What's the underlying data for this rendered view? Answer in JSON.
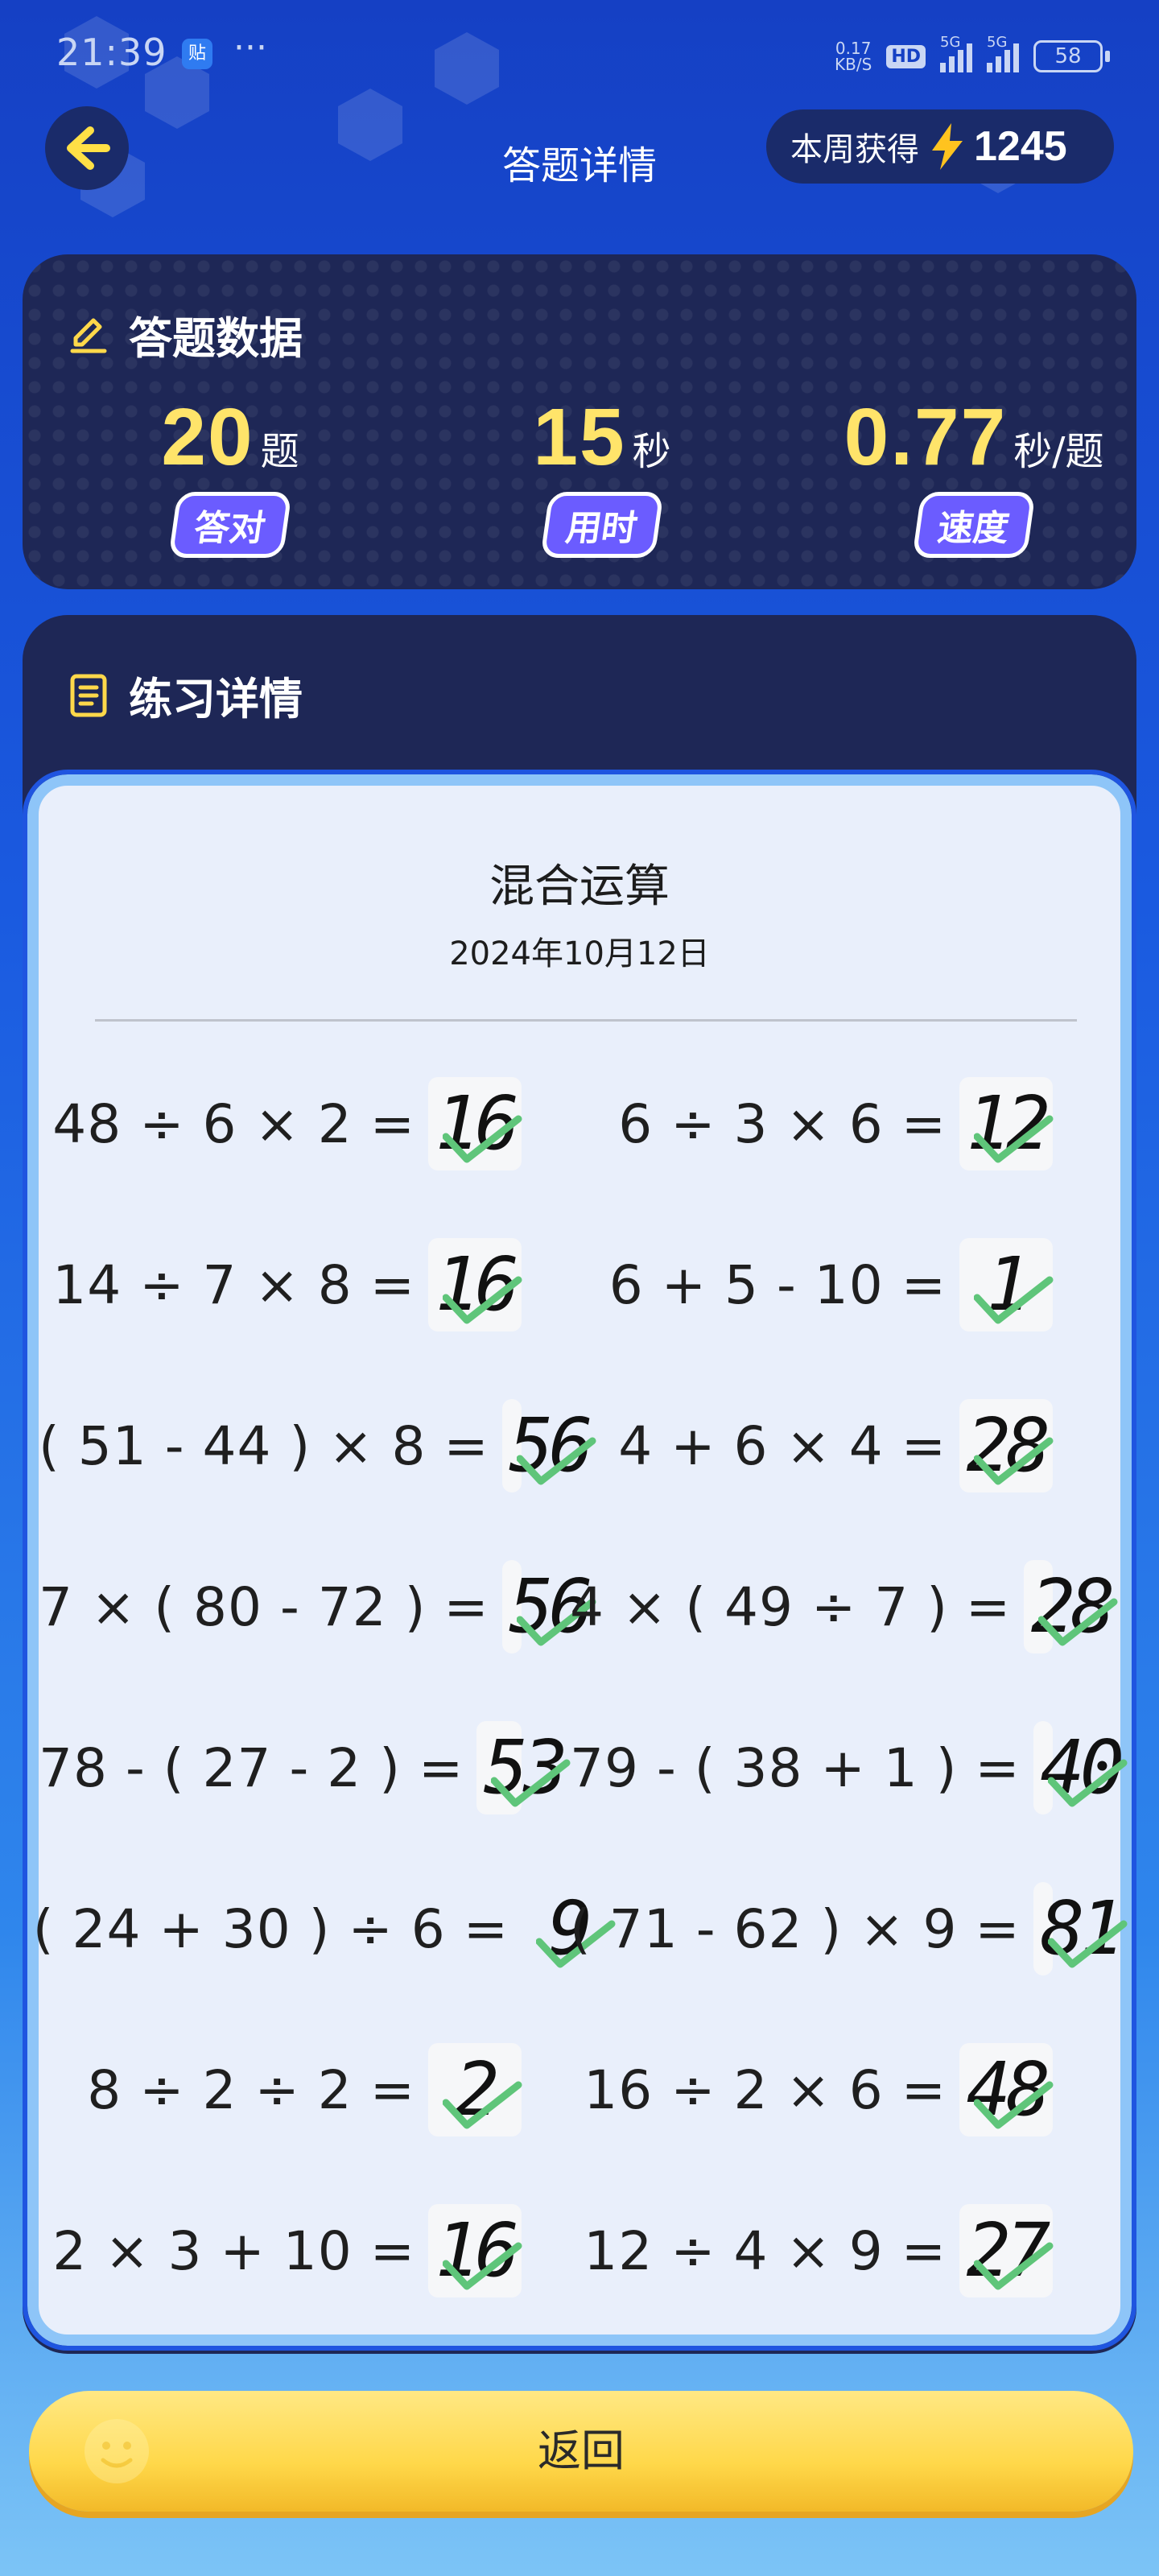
{
  "status_bar": {
    "time": "21:39",
    "sticker": "贴",
    "more": "···",
    "net_speed_value": "0.17",
    "net_speed_unit": "KB/S",
    "hd_label": "HD",
    "signal_label_1": "5G",
    "signal_label_2": "5G",
    "battery": "58"
  },
  "header": {
    "title": "答题详情",
    "weekly_label": "本周获得",
    "weekly_value": "1245"
  },
  "stats": {
    "heading": "答题数据",
    "items": [
      {
        "value": "20",
        "unit": "题",
        "tag": "答对"
      },
      {
        "value": "15",
        "unit": "秒",
        "tag": "用时"
      },
      {
        "value": "0.77",
        "unit": "秒/题",
        "tag": "速度"
      }
    ]
  },
  "practice": {
    "heading": "练习详情",
    "sheet_title": "混合运算",
    "sheet_date": "2024年10月12日",
    "questions": [
      {
        "expr": "48 ÷ 6 × 2 =",
        "answer": "16"
      },
      {
        "expr": "6 ÷ 3 × 6 =",
        "answer": "12"
      },
      {
        "expr": "14 ÷ 7 × 8 =",
        "answer": "16"
      },
      {
        "expr": "6 + 5 - 10 =",
        "answer": "1"
      },
      {
        "expr": "( 51 - 44 ) × 8 =",
        "answer": "56"
      },
      {
        "expr": "4 + 6 × 4 =",
        "answer": "28"
      },
      {
        "expr": "7 × ( 80 - 72 ) =",
        "answer": "56"
      },
      {
        "expr": "4 × ( 49 ÷ 7 ) =",
        "answer": "28"
      },
      {
        "expr": "78 - ( 27 - 2 ) =",
        "answer": "53"
      },
      {
        "expr": "79 - ( 38 + 1 ) =",
        "answer": "40"
      },
      {
        "expr": "( 24 + 30 ) ÷ 6 =",
        "answer": "9"
      },
      {
        "expr": "( 71 - 62 ) × 9 =",
        "answer": "81"
      },
      {
        "expr": "8 ÷ 2 ÷ 2 =",
        "answer": "2"
      },
      {
        "expr": "16 ÷ 2 × 6 =",
        "answer": "48"
      },
      {
        "expr": "2 × 3 + 10 =",
        "answer": "16"
      },
      {
        "expr": "12 ÷ 4 × 9 =",
        "answer": "27"
      }
    ]
  },
  "footer": {
    "return_label": "返回"
  },
  "colors": {
    "accent_yellow": "#ffe46a",
    "check_green": "#5fc57a",
    "card_navy": "#1e2756"
  }
}
